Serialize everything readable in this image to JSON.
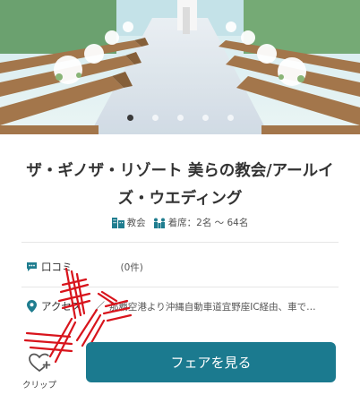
{
  "hero": {
    "image_icon": "chapel-aisle-photo",
    "slide_count": 5,
    "active_slide": 1
  },
  "venue": {
    "title": "ザ・ギノザ・リゾート 美らの教会/アールイズ・ウエディング",
    "type_icon": "building-icon",
    "type_label": "教会",
    "seats_icon": "people-icon",
    "seats_label": "着席：2名 〜 64名"
  },
  "reviews": {
    "icon": "chat-icon",
    "label": "口コミ",
    "count": "(0件)"
  },
  "access": {
    "icon": "location-pin-icon",
    "label": "アクセス",
    "text": "那覇空港より沖縄自動車道宜野座IC経由、車で…"
  },
  "footer": {
    "clip_icon": "heart-plus-icon",
    "clip_label": "クリップ",
    "fair_button": "フェアを見る"
  },
  "colors": {
    "accent": "#1b7a8f",
    "icon_teal": "#1f7d8f",
    "scribble": "#d8141c"
  }
}
